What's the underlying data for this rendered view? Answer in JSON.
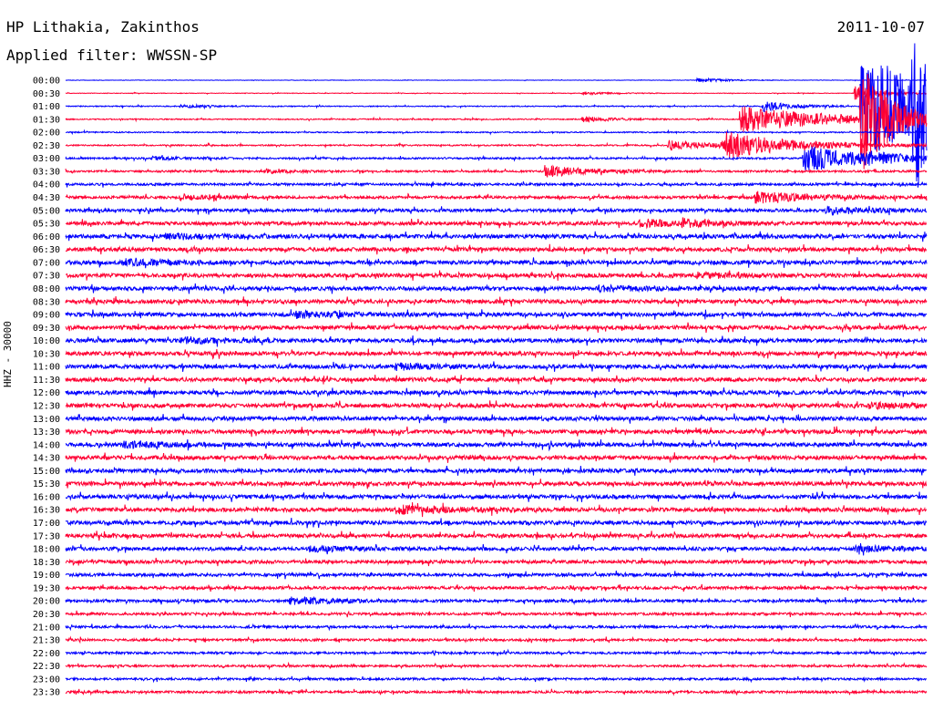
{
  "header": {
    "station": "HP Lithakia, Zakinthos",
    "filter": "Applied filter: WWSSN-SP",
    "date": "2011-10-07"
  },
  "chart_data": {
    "type": "line",
    "title": "HP Lithakia, Zakinthos",
    "subtitle": "Applied filter: WWSSN-SP",
    "date": "2011-10-07",
    "ylabel": "HHZ - 30000",
    "xlabel": "",
    "tick_labels": [
      "00:00",
      "00:30",
      "01:00",
      "01:30",
      "02:00",
      "02:30",
      "03:00",
      "03:30",
      "04:00",
      "04:30",
      "05:00",
      "05:30",
      "06:00",
      "06:30",
      "07:00",
      "07:30",
      "08:00",
      "08:30",
      "09:00",
      "09:30",
      "10:00",
      "10:30",
      "11:00",
      "11:30",
      "12:00",
      "12:30",
      "13:00",
      "13:30",
      "14:00",
      "14:30",
      "15:00",
      "15:30",
      "16:00",
      "16:30",
      "17:00",
      "17:30",
      "18:00",
      "18:30",
      "19:00",
      "19:30",
      "20:00",
      "20:30",
      "21:00",
      "21:30",
      "22:00",
      "22:30",
      "23:00",
      "23:30"
    ],
    "trace_colors": [
      "#0000ff",
      "#ff0033"
    ],
    "baseline_noise": [
      0.1,
      0.15,
      0.25,
      0.28,
      0.3,
      0.35,
      0.45,
      0.5,
      0.6,
      0.7,
      0.8,
      0.9,
      1.0,
      1.0,
      1.0,
      1.0,
      1.0,
      1.0,
      1.0,
      1.0,
      1.0,
      1.0,
      1.0,
      1.0,
      1.0,
      1.0,
      1.0,
      1.0,
      1.0,
      1.0,
      1.0,
      1.0,
      1.0,
      1.0,
      1.0,
      0.95,
      0.9,
      0.85,
      0.8,
      0.75,
      0.7,
      0.65,
      0.6,
      0.6,
      0.55,
      0.55,
      0.55,
      0.6
    ],
    "events": [
      {
        "row": 0,
        "minute": 22,
        "amplitude": 2.5,
        "duration": 1.0
      },
      {
        "row": 1,
        "minute": 18,
        "amplitude": 1.5,
        "duration": 1.0
      },
      {
        "row": 1,
        "minute": 27.5,
        "amplitude": 8,
        "duration": 1.0
      },
      {
        "row": 2,
        "minute": 4,
        "amplitude": 1.5,
        "duration": 1.0
      },
      {
        "row": 2,
        "minute": 24.3,
        "amplitude": 6,
        "duration": 1.0
      },
      {
        "row": 2,
        "minute": 27.7,
        "amplitude": 60,
        "duration": 3.0
      },
      {
        "row": 2,
        "minute": 29.5,
        "amplitude": 70,
        "duration": 1.0
      },
      {
        "row": 3,
        "minute": 27.7,
        "amplitude": 60,
        "duration": 1.0
      },
      {
        "row": 3,
        "minute": 18,
        "amplitude": 3,
        "duration": 1.0
      },
      {
        "row": 3,
        "minute": 23.5,
        "amplitude": 15,
        "duration": 3.0
      },
      {
        "row": 5,
        "minute": 21,
        "amplitude": 5,
        "duration": 1.5
      },
      {
        "row": 5,
        "minute": 23,
        "amplitude": 12,
        "duration": 2.5
      },
      {
        "row": 5,
        "minute": 22.8,
        "amplitude": 3,
        "duration": 1.0
      },
      {
        "row": 6,
        "minute": 28,
        "amplitude": 3,
        "duration": 1.5
      },
      {
        "row": 6,
        "minute": 25.7,
        "amplitude": 15,
        "duration": 2.0
      },
      {
        "row": 6,
        "minute": 3,
        "amplitude": 1.5,
        "duration": 1.0
      },
      {
        "row": 7,
        "minute": 16.7,
        "amplitude": 6,
        "duration": 1.5
      },
      {
        "row": 7,
        "minute": 7,
        "amplitude": 2,
        "duration": 1.0
      },
      {
        "row": 9,
        "minute": 24,
        "amplitude": 6,
        "duration": 2.0
      },
      {
        "row": 9,
        "minute": 4,
        "amplitude": 3,
        "duration": 1.0
      },
      {
        "row": 10,
        "minute": 26.5,
        "amplitude": 4,
        "duration": 1.5
      },
      {
        "row": 11,
        "minute": 20,
        "amplitude": 4,
        "duration": 1.5
      },
      {
        "row": 11,
        "minute": 21.5,
        "amplitude": 3,
        "duration": 1.0
      },
      {
        "row": 12,
        "minute": 3.5,
        "amplitude": 3,
        "duration": 1.5
      },
      {
        "row": 14,
        "minute": 2,
        "amplitude": 3,
        "duration": 1.5
      },
      {
        "row": 15,
        "minute": 22,
        "amplitude": 2.5,
        "duration": 1.5
      },
      {
        "row": 16,
        "minute": 18.5,
        "amplitude": 2.5,
        "duration": 1.5
      },
      {
        "row": 18,
        "minute": 8,
        "amplitude": 3,
        "duration": 1.5
      },
      {
        "row": 20,
        "minute": 4,
        "amplitude": 2.5,
        "duration": 1.5
      },
      {
        "row": 22,
        "minute": 11.5,
        "amplitude": 3,
        "duration": 1.5
      },
      {
        "row": 25,
        "minute": 28,
        "amplitude": 2.5,
        "duration": 1.5
      },
      {
        "row": 28,
        "minute": 2,
        "amplitude": 3,
        "duration": 1.5
      },
      {
        "row": 33,
        "minute": 11.5,
        "amplitude": 4,
        "duration": 2.0
      },
      {
        "row": 36,
        "minute": 8.5,
        "amplitude": 2.5,
        "duration": 1.5
      },
      {
        "row": 36,
        "minute": 27.5,
        "amplitude": 3,
        "duration": 1.5
      },
      {
        "row": 40,
        "minute": 7.8,
        "amplitude": 4,
        "duration": 1.5
      }
    ]
  }
}
